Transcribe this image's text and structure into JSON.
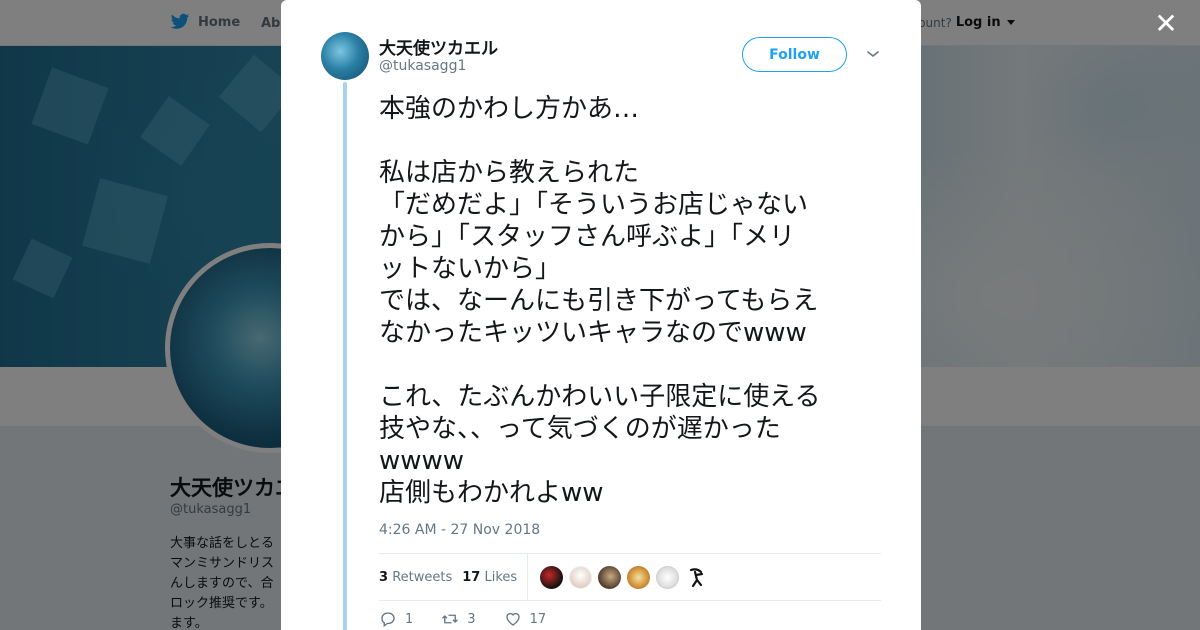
{
  "nav": {
    "home": "Home",
    "about": "Abo",
    "account_prompt": "ccount?",
    "login": "Log in"
  },
  "profile": {
    "name": "大天使ツカエル",
    "handle": "@tukasagg1",
    "bio_lines": [
      "大事な話をしとる",
      "マンミサンドリス",
      "んしますので、合",
      "ロック推奨です。",
      "ます。"
    ]
  },
  "tweet": {
    "author_name": "大天使ツカエル",
    "author_handle": "@tukasagg1",
    "follow_label": "Follow",
    "text": "本強のかわし方かあ…\n\n私は店から教えられた\n「だめだよ」「そういうお店じゃない\nから」「スタッフさん呼ぶよ」「メリ\nットないから」\nでは、なーんにも引き下がってもらえ\nなかったキッツいキャラなのでwww\n\nこれ、たぶんかわいい子限定に使える\n技やな、、って気づくのが遅かった\nwwww\n店側もわかれよww",
    "timestamp": "4:26 AM - 27 Nov 2018",
    "retweets_count": "3",
    "retweets_label": "Retweets",
    "likes_count": "17",
    "likes_label": "Likes",
    "likers": [
      "#7a1b1b",
      "#e9e4e0",
      "#5a4a3a",
      "#d4a04a",
      "#f2f2f2",
      "#ffffff"
    ],
    "actions": {
      "reply": "1",
      "retweet": "3",
      "like": "17"
    }
  },
  "colors": {
    "accent": "#1da1f2",
    "thread_line": "#a6d3f0"
  }
}
